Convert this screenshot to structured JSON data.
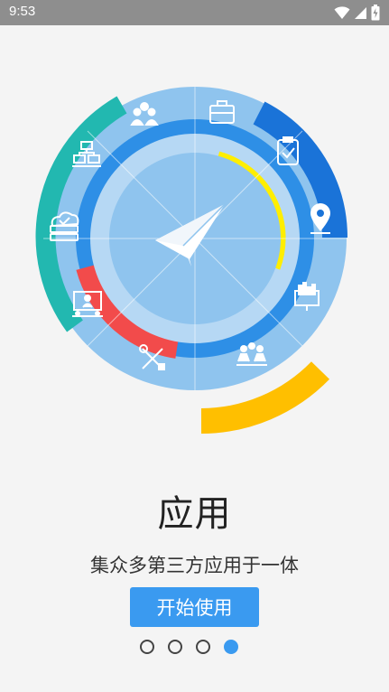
{
  "status_bar": {
    "time": "9:53",
    "icons": [
      "wifi-icon",
      "cellular-signal-icon",
      "battery-icon"
    ]
  },
  "hero": {
    "center_icon": "paper-plane-icon",
    "ring_icons": [
      "team-icon",
      "briefcase-icon",
      "clipboard-check-icon",
      "location-pin-icon",
      "dashboard-monitor-icon",
      "meeting-icon",
      "tools-icon",
      "presentation-icon",
      "cloud-storage-icon",
      "network-computers-icon"
    ],
    "colors": {
      "outer_ring": "#8fc4ee",
      "middle_ring": "#2e8fe6",
      "inner_ring": "#b6d8f4",
      "core": "#8fc4ee",
      "teal_arc": "#22b8b0",
      "dark_blue_arc": "#1a73d8",
      "yellow_arc": "#ffee00",
      "red_arc": "#f24b4b",
      "orange_arc": "#ffbf00"
    }
  },
  "title": "应用",
  "subtitle": "集众多第三方应用于一体",
  "start_button": {
    "label": "开始使用",
    "color": "#3a9af0"
  },
  "pager": {
    "count": 4,
    "active_index": 3
  }
}
